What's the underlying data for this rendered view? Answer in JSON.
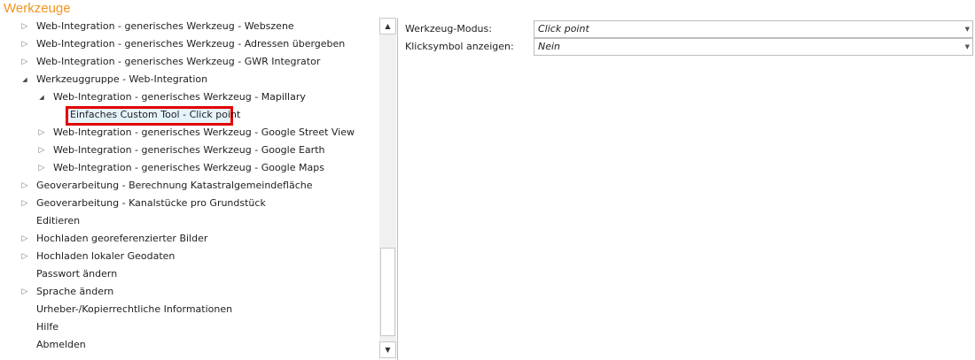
{
  "title": "Werkzeuge",
  "tree": [
    {
      "label": "Web-Integration - generisches Werkzeug - Webszene",
      "level": 0,
      "state": "collapsed"
    },
    {
      "label": "Web-Integration - generisches Werkzeug - Adressen übergeben",
      "level": 0,
      "state": "collapsed"
    },
    {
      "label": "Web-Integration - generisches Werkzeug - GWR Integrator",
      "level": 0,
      "state": "collapsed"
    },
    {
      "label": "Werkzeuggruppe - Web-Integration",
      "level": 0,
      "state": "expanded"
    },
    {
      "label": "Web-Integration - generisches Werkzeug - Mapillary",
      "level": 1,
      "state": "expanded"
    },
    {
      "label": "Einfaches Custom Tool - Click point",
      "level": 2,
      "state": "leaf",
      "selected": true
    },
    {
      "label": "Web-Integration - generisches Werkzeug - Google Street View",
      "level": 1,
      "state": "collapsed"
    },
    {
      "label": "Web-Integration - generisches Werkzeug - Google Earth",
      "level": 1,
      "state": "collapsed"
    },
    {
      "label": "Web-Integration - generisches Werkzeug - Google Maps",
      "level": 1,
      "state": "collapsed"
    },
    {
      "label": "Geoverarbeitung - Berechnung Katastralgemeindefläche",
      "level": 0,
      "state": "collapsed"
    },
    {
      "label": "Geoverarbeitung - Kanalstücke pro Grundstück",
      "level": 0,
      "state": "collapsed"
    },
    {
      "label": "Editieren",
      "level": 0,
      "state": "leaf"
    },
    {
      "label": "Hochladen georeferenzierter Bilder",
      "level": 0,
      "state": "collapsed"
    },
    {
      "label": "Hochladen lokaler Geodaten",
      "level": 0,
      "state": "collapsed"
    },
    {
      "label": "Passwort ändern",
      "level": 0,
      "state": "leaf"
    },
    {
      "label": "Sprache ändern",
      "level": 0,
      "state": "collapsed"
    },
    {
      "label": "Urheber-/Kopierrechtliche Informationen",
      "level": 0,
      "state": "leaf"
    },
    {
      "label": "Hilfe",
      "level": 0,
      "state": "leaf"
    },
    {
      "label": "Abmelden",
      "level": 0,
      "state": "leaf"
    }
  ],
  "properties": [
    {
      "label": "Werkzeug-Modus:",
      "value": "Click point"
    },
    {
      "label": "Klicksymbol anzeigen:",
      "value": "Nein"
    }
  ],
  "colors": {
    "title": "#f0961e",
    "selection_border": "#e00000"
  }
}
